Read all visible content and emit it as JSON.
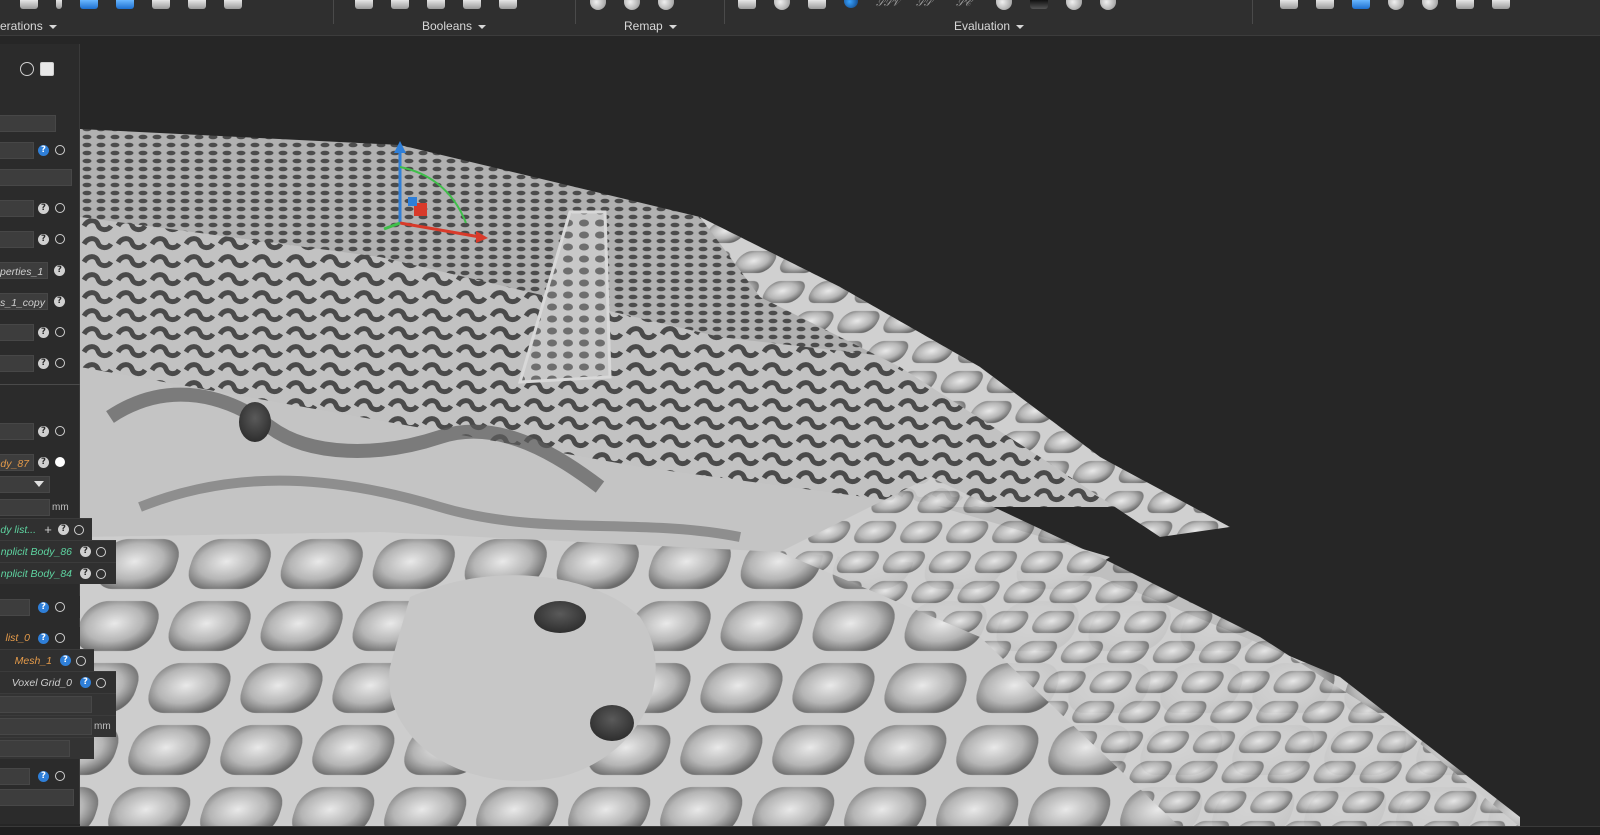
{
  "ribbon": {
    "groups": [
      {
        "label": "erations"
      },
      {
        "label": "Booleans"
      },
      {
        "label": "Remap"
      },
      {
        "label": "Evaluation"
      }
    ]
  },
  "panel": {
    "rows": {
      "properties": "perties_1",
      "properties_copy": "s_1_copy",
      "body_87": "dy_87",
      "body_list": "dy list...",
      "implicit_86": "nplicit Body_86",
      "implicit_84": "nplicit Body_84",
      "list_0": "list_0",
      "mesh": "Mesh_1",
      "voxel": "Voxel Grid_0"
    },
    "unit_mm": "mm",
    "help_glyph": "?"
  },
  "colors": {
    "accent_blue": "#2f7fd8",
    "label_green": "#5ed3a0",
    "label_orange": "#e39a4a",
    "viewport_bg": "#262626"
  },
  "icons": [
    "rotate-icon",
    "copy-icon",
    "help-icon",
    "port-icon",
    "add-icon",
    "dropdown-arrow-icon",
    "transform-gizmo-icon"
  ]
}
